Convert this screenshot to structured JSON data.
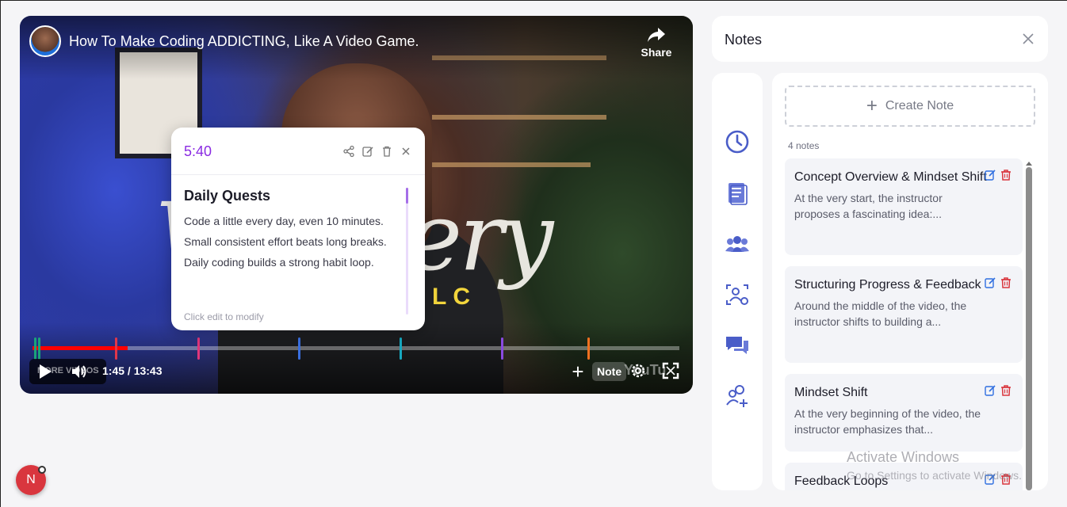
{
  "player": {
    "title": "How To Make Coding ADDICTING, Like A Video Game.",
    "share_label": "Share",
    "more_videos_label": "MORE VIDEOS",
    "time_readout": "1:45 / 13:43",
    "progress_fraction": 0.147,
    "add_note_label": "Note",
    "yt_logo_text": "YouTu",
    "markers": [
      {
        "fraction": 0.002,
        "color": "#1aa37a"
      },
      {
        "fraction": 0.008,
        "color": "#1aa37a"
      },
      {
        "fraction": 0.128,
        "color": "#e0364a"
      },
      {
        "fraction": 0.255,
        "color": "#e0367a"
      },
      {
        "fraction": 0.41,
        "color": "#3a6fe0"
      },
      {
        "fraction": 0.567,
        "color": "#17a8c0"
      },
      {
        "fraction": 0.724,
        "color": "#8a4ae0"
      },
      {
        "fraction": 0.858,
        "color": "#f07020"
      }
    ]
  },
  "popup": {
    "time": "5:40",
    "heading": "Daily Quests",
    "lines": [
      "Code a little every day, even 10 minutes.",
      "Small consistent effort beats long breaks.",
      "Daily coding builds a strong habit loop."
    ],
    "hint": "Click edit to modify"
  },
  "notes": {
    "title": "Notes",
    "create_label": "Create Note",
    "count_label": "4 notes",
    "items": [
      {
        "title": "Concept Overview & Mindset Shift",
        "text": "At the very start, the instructor proposes a fascinating idea:..."
      },
      {
        "title": "Structuring Progress & Feedback",
        "text": "Around the middle of the video, the instructor shifts to building a..."
      },
      {
        "title": "Mindset Shift",
        "text": "At the very beginning of the video, the instructor emphasizes that..."
      },
      {
        "title": "Feedback Loops",
        "text": ""
      }
    ]
  },
  "rail_icons": [
    "clock-icon",
    "notes-list-icon",
    "group-icon",
    "user-scan-icon",
    "chat-icon",
    "add-user-icon"
  ],
  "watermark": {
    "line1": "Activate Windows",
    "line2": "Go to Settings to activate Windows."
  },
  "floating_badge": {
    "letter": "N"
  },
  "colors": {
    "accent": "#8a2be2",
    "edit": "#2f6fe0",
    "delete": "#d9363e",
    "rail_icon": "#4a5dc8"
  }
}
